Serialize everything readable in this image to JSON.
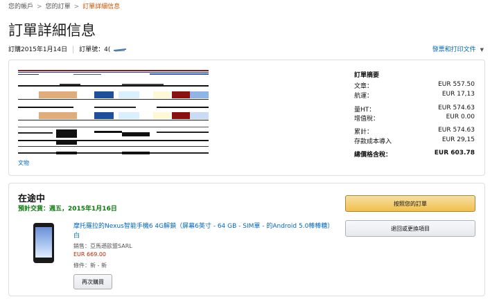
{
  "breadcrumb": {
    "items": [
      "您的帳戶",
      "您的訂單"
    ],
    "current": "訂單詳細信息",
    "separator": ">"
  },
  "page": {
    "title": "訂單詳細信息",
    "order_date": "訂購2015年1月14日",
    "order_number_label": "訂單號：4(",
    "invoice_label": "發票和打印文件",
    "invoice_caret": "▼"
  },
  "shipping_block": {
    "link_text": "文物"
  },
  "summary": {
    "title": "訂單摘要",
    "rows": [
      {
        "label": "文章：",
        "value": "EUR 557.50"
      },
      {
        "label": "航運：",
        "value": "EUR 17,13"
      },
      {
        "label": "量HT：",
        "value": "EUR 574.63"
      },
      {
        "label": "增值稅：",
        "value": "EUR 0.00"
      },
      {
        "label": "累計：",
        "value": "EUR 574.63"
      },
      {
        "label": "存款成本導入",
        "value": "EUR 29,15"
      }
    ],
    "total": {
      "label": "總價格含稅：",
      "value": "EUR 603.78"
    }
  },
  "shipment": {
    "status": "在途中",
    "delivery": "預計交貨：週五，2015年1月16日",
    "product_title": "摩托羅拉的Nexus智能手機6 4G解鎖（屏幕6英寸 - 64 GB - SIM單 - 的Android 5.0棒棒糖）白",
    "seller": "銷售：亞馬遜歐盟SARL",
    "price": "EUR 669.00",
    "condition": "條件：新 - 新",
    "buy_again_label": "再次購買",
    "track_button_label": "按照您的訂單",
    "return_button_label": "退回或更換項目"
  },
  "colors": {
    "link": "#0066c0",
    "breadcrumb_current": "#c45500",
    "delivery_green": "#0a7a0a",
    "price_red": "#b12704",
    "primary_button": "#f0c14b"
  }
}
